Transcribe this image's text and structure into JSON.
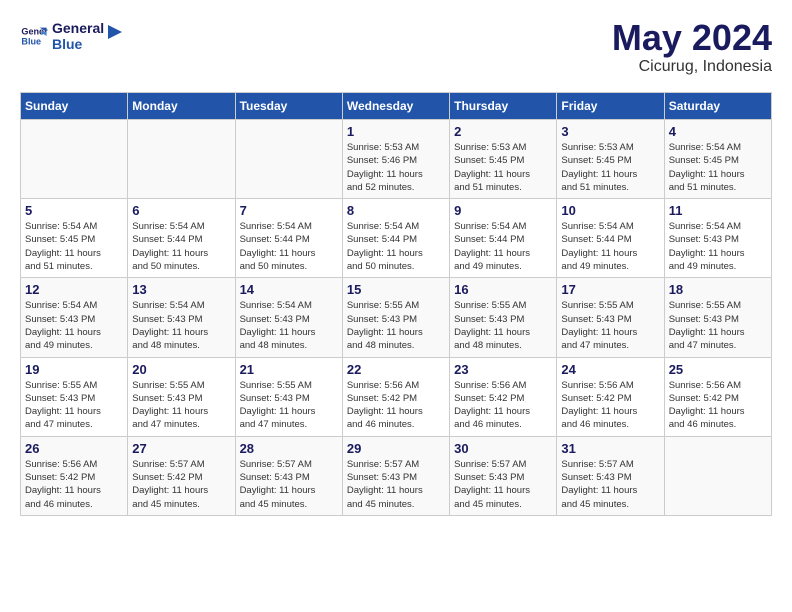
{
  "header": {
    "logo_line1": "General",
    "logo_line2": "Blue",
    "month": "May 2024",
    "location": "Cicurug, Indonesia"
  },
  "weekdays": [
    "Sunday",
    "Monday",
    "Tuesday",
    "Wednesday",
    "Thursday",
    "Friday",
    "Saturday"
  ],
  "weeks": [
    [
      {
        "day": "",
        "info": ""
      },
      {
        "day": "",
        "info": ""
      },
      {
        "day": "",
        "info": ""
      },
      {
        "day": "1",
        "info": "Sunrise: 5:53 AM\nSunset: 5:46 PM\nDaylight: 11 hours\nand 52 minutes."
      },
      {
        "day": "2",
        "info": "Sunrise: 5:53 AM\nSunset: 5:45 PM\nDaylight: 11 hours\nand 51 minutes."
      },
      {
        "day": "3",
        "info": "Sunrise: 5:53 AM\nSunset: 5:45 PM\nDaylight: 11 hours\nand 51 minutes."
      },
      {
        "day": "4",
        "info": "Sunrise: 5:54 AM\nSunset: 5:45 PM\nDaylight: 11 hours\nand 51 minutes."
      }
    ],
    [
      {
        "day": "5",
        "info": "Sunrise: 5:54 AM\nSunset: 5:45 PM\nDaylight: 11 hours\nand 51 minutes."
      },
      {
        "day": "6",
        "info": "Sunrise: 5:54 AM\nSunset: 5:44 PM\nDaylight: 11 hours\nand 50 minutes."
      },
      {
        "day": "7",
        "info": "Sunrise: 5:54 AM\nSunset: 5:44 PM\nDaylight: 11 hours\nand 50 minutes."
      },
      {
        "day": "8",
        "info": "Sunrise: 5:54 AM\nSunset: 5:44 PM\nDaylight: 11 hours\nand 50 minutes."
      },
      {
        "day": "9",
        "info": "Sunrise: 5:54 AM\nSunset: 5:44 PM\nDaylight: 11 hours\nand 49 minutes."
      },
      {
        "day": "10",
        "info": "Sunrise: 5:54 AM\nSunset: 5:44 PM\nDaylight: 11 hours\nand 49 minutes."
      },
      {
        "day": "11",
        "info": "Sunrise: 5:54 AM\nSunset: 5:43 PM\nDaylight: 11 hours\nand 49 minutes."
      }
    ],
    [
      {
        "day": "12",
        "info": "Sunrise: 5:54 AM\nSunset: 5:43 PM\nDaylight: 11 hours\nand 49 minutes."
      },
      {
        "day": "13",
        "info": "Sunrise: 5:54 AM\nSunset: 5:43 PM\nDaylight: 11 hours\nand 48 minutes."
      },
      {
        "day": "14",
        "info": "Sunrise: 5:54 AM\nSunset: 5:43 PM\nDaylight: 11 hours\nand 48 minutes."
      },
      {
        "day": "15",
        "info": "Sunrise: 5:55 AM\nSunset: 5:43 PM\nDaylight: 11 hours\nand 48 minutes."
      },
      {
        "day": "16",
        "info": "Sunrise: 5:55 AM\nSunset: 5:43 PM\nDaylight: 11 hours\nand 48 minutes."
      },
      {
        "day": "17",
        "info": "Sunrise: 5:55 AM\nSunset: 5:43 PM\nDaylight: 11 hours\nand 47 minutes."
      },
      {
        "day": "18",
        "info": "Sunrise: 5:55 AM\nSunset: 5:43 PM\nDaylight: 11 hours\nand 47 minutes."
      }
    ],
    [
      {
        "day": "19",
        "info": "Sunrise: 5:55 AM\nSunset: 5:43 PM\nDaylight: 11 hours\nand 47 minutes."
      },
      {
        "day": "20",
        "info": "Sunrise: 5:55 AM\nSunset: 5:43 PM\nDaylight: 11 hours\nand 47 minutes."
      },
      {
        "day": "21",
        "info": "Sunrise: 5:55 AM\nSunset: 5:43 PM\nDaylight: 11 hours\nand 47 minutes."
      },
      {
        "day": "22",
        "info": "Sunrise: 5:56 AM\nSunset: 5:42 PM\nDaylight: 11 hours\nand 46 minutes."
      },
      {
        "day": "23",
        "info": "Sunrise: 5:56 AM\nSunset: 5:42 PM\nDaylight: 11 hours\nand 46 minutes."
      },
      {
        "day": "24",
        "info": "Sunrise: 5:56 AM\nSunset: 5:42 PM\nDaylight: 11 hours\nand 46 minutes."
      },
      {
        "day": "25",
        "info": "Sunrise: 5:56 AM\nSunset: 5:42 PM\nDaylight: 11 hours\nand 46 minutes."
      }
    ],
    [
      {
        "day": "26",
        "info": "Sunrise: 5:56 AM\nSunset: 5:42 PM\nDaylight: 11 hours\nand 46 minutes."
      },
      {
        "day": "27",
        "info": "Sunrise: 5:57 AM\nSunset: 5:42 PM\nDaylight: 11 hours\nand 45 minutes."
      },
      {
        "day": "28",
        "info": "Sunrise: 5:57 AM\nSunset: 5:43 PM\nDaylight: 11 hours\nand 45 minutes."
      },
      {
        "day": "29",
        "info": "Sunrise: 5:57 AM\nSunset: 5:43 PM\nDaylight: 11 hours\nand 45 minutes."
      },
      {
        "day": "30",
        "info": "Sunrise: 5:57 AM\nSunset: 5:43 PM\nDaylight: 11 hours\nand 45 minutes."
      },
      {
        "day": "31",
        "info": "Sunrise: 5:57 AM\nSunset: 5:43 PM\nDaylight: 11 hours\nand 45 minutes."
      },
      {
        "day": "",
        "info": ""
      }
    ]
  ]
}
